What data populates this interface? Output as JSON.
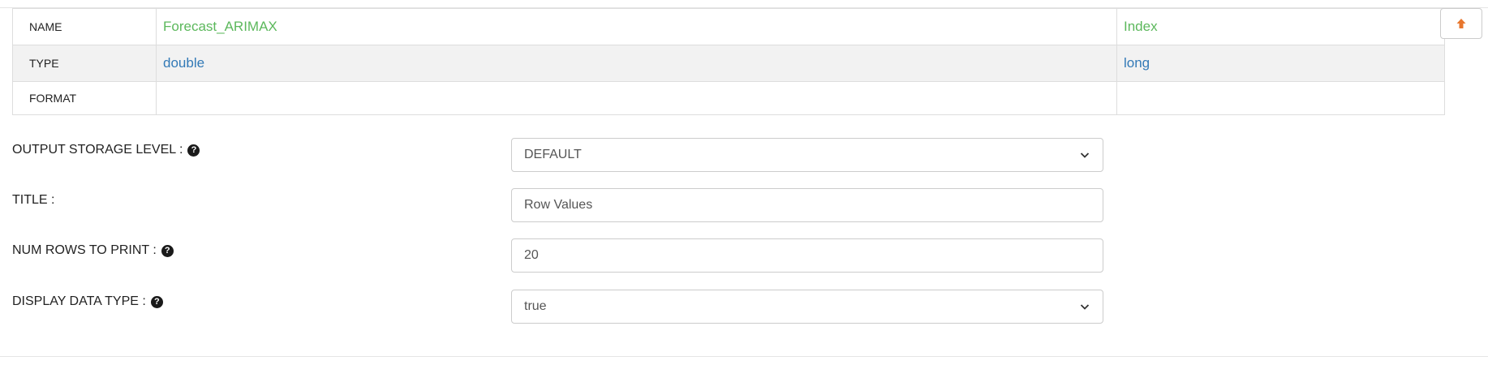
{
  "schema_table": {
    "rows": [
      {
        "label": "NAME",
        "values": [
          "Forecast_ARIMAX",
          "Index"
        ]
      },
      {
        "label": "TYPE",
        "values": [
          "double",
          "long"
        ]
      },
      {
        "label": "FORMAT",
        "values": [
          "",
          ""
        ]
      }
    ]
  },
  "form": {
    "output_storage_level": {
      "label": "OUTPUT STORAGE LEVEL :",
      "value": "DEFAULT"
    },
    "title": {
      "label": "TITLE :",
      "value": "Row Values"
    },
    "num_rows_to_print": {
      "label": "NUM ROWS TO PRINT :",
      "value": "20"
    },
    "display_data_type": {
      "label": "DISPLAY DATA TYPE :",
      "value": "true"
    }
  },
  "icons": {
    "scroll_top": "arrow-up-icon",
    "help": "question-circle-icon",
    "dropdown": "chevron-down-icon"
  },
  "colors": {
    "name_value": "#5cb85c",
    "type_value": "#337ab7",
    "scroll_top_arrow": "#e8772e"
  }
}
